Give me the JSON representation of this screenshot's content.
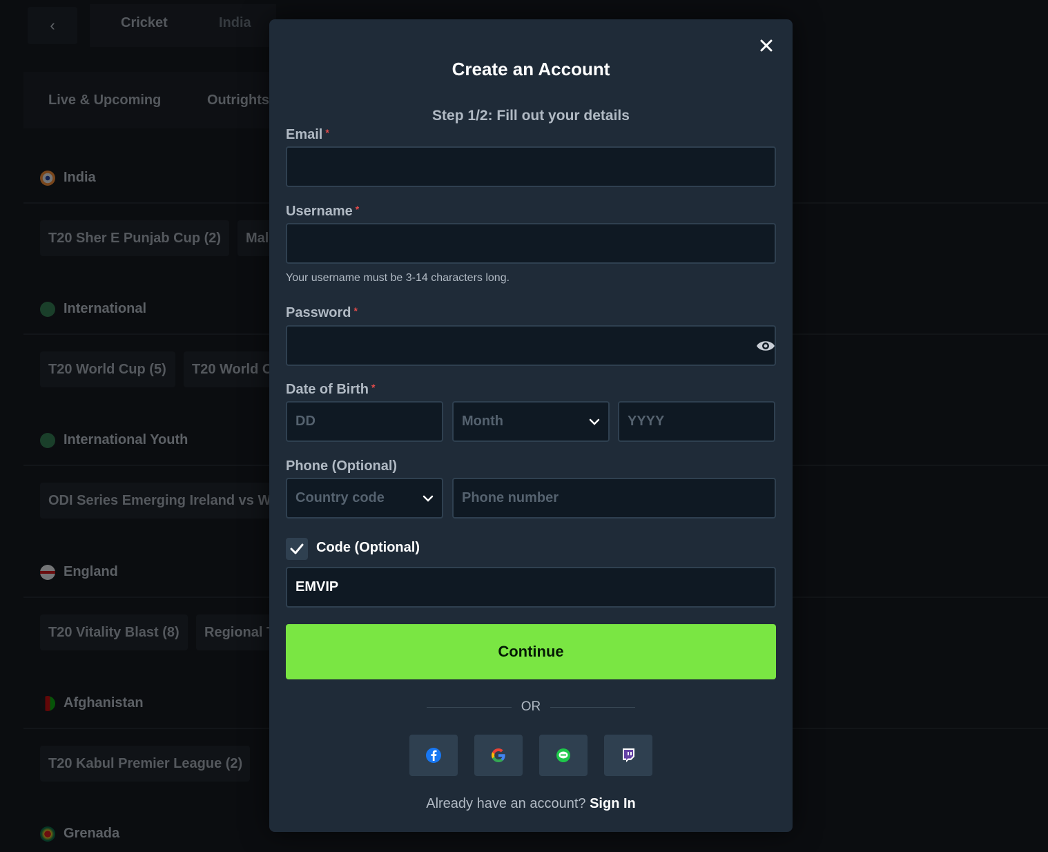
{
  "background": {
    "breadcrumbs": [
      "Cricket",
      "India"
    ],
    "tabs": [
      "Live & Upcoming",
      "Outrights"
    ],
    "sections": [
      {
        "title": "India",
        "chips": [
          "T20 Sher E Punjab Cup (2)",
          "Mal"
        ]
      },
      {
        "title": "International",
        "chips": [
          "T20 World Cup (5)",
          "T20 World C"
        ]
      },
      {
        "title": "International Youth",
        "chips": [
          "ODI Series Emerging Ireland vs W"
        ]
      },
      {
        "title": "England",
        "chips": [
          "T20 Vitality Blast (8)",
          "Regional T"
        ]
      },
      {
        "title": "Afghanistan",
        "chips": [
          "T20 Kabul Premier League (2)"
        ]
      },
      {
        "title": "Grenada",
        "chips": []
      }
    ]
  },
  "modal": {
    "title": "Create an Account",
    "step": "Step 1/2: Fill out your details",
    "email": {
      "label": "Email",
      "required": "*",
      "value": ""
    },
    "username": {
      "label": "Username",
      "required": "*",
      "value": "",
      "hint": "Your username must be 3-14 characters long."
    },
    "password": {
      "label": "Password",
      "required": "*",
      "value": ""
    },
    "dob": {
      "label": "Date of Birth",
      "required": "*",
      "day_placeholder": "DD",
      "month_placeholder": "Month",
      "year_placeholder": "YYYY"
    },
    "phone": {
      "label": "Phone (Optional)",
      "country_placeholder": "Country code",
      "number_placeholder": "Phone number"
    },
    "code": {
      "label": "Code (Optional)",
      "checked": true,
      "value": "EMVIP"
    },
    "continue_label": "Continue",
    "or_text": "OR",
    "social": [
      "facebook-icon",
      "google-icon",
      "line-icon",
      "twitch-icon"
    ],
    "signin_prompt": "Already have an account?",
    "signin_link": "Sign In"
  },
  "colors": {
    "modal_bg": "#1f2b38",
    "input_bg": "#0f1923",
    "accent_green": "#7ae643",
    "required_red": "#e24b4b"
  }
}
